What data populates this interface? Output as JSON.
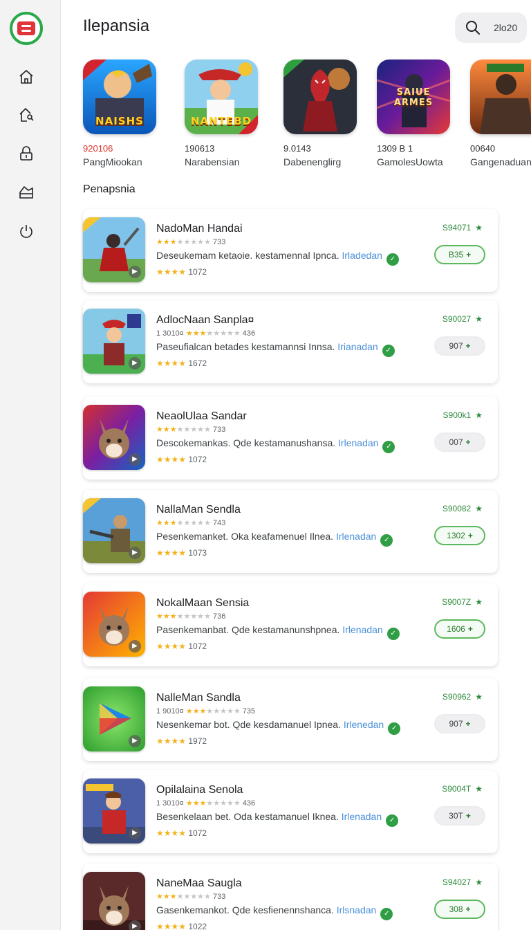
{
  "header": {
    "title": "Ilepansia",
    "search_text": "2lo20"
  },
  "nav": {
    "items": [
      "home",
      "store",
      "library",
      "deals",
      "power"
    ]
  },
  "featured": [
    {
      "number": "920106",
      "name": "PangMiookan",
      "banner": "NAISHS",
      "highlight": true
    },
    {
      "number": "190613",
      "name": "Narabensian",
      "banner": "NANTEBD",
      "highlight": false
    },
    {
      "number": "9.0143",
      "name": "Dabenenglirg",
      "banner": "",
      "highlight": false
    },
    {
      "number": "1309 B 1",
      "name": "GamolesUowta",
      "banner": "SAIUE ARMES",
      "highlight": false
    },
    {
      "number": "00640",
      "name": "Gangenaduan",
      "banner": "",
      "highlight": false
    }
  ],
  "section_title": "Penapsnia",
  "apps": [
    {
      "name": "NadoMan Handai",
      "sub_prefix": "",
      "sub_count": "733",
      "description": "Deseukemam ketaoie. kestamennal Ipnca.",
      "link": "Irladedan",
      "rating_count": "1072",
      "price": "S94071",
      "button": "B35",
      "button_style": "outline",
      "art": "warrior"
    },
    {
      "name": "AdlocNaan Sanpla¤",
      "sub_prefix": "1 3010¤",
      "sub_count": "436",
      "description": "Paseufialcan betades kestamannsi Innsa.",
      "link": "Irianadan",
      "rating_count": "1672",
      "price": "S90027",
      "button": "907",
      "button_style": "filled",
      "art": "hero"
    },
    {
      "name": "NeaolUlaa Sandar",
      "sub_prefix": "",
      "sub_count": "733",
      "description": "Descokemankas. Qde kestamanushansa.",
      "link": "Irlenadan",
      "rating_count": "1072",
      "price": "S900k1",
      "button": "007",
      "button_style": "filled",
      "art": "fox"
    },
    {
      "name": "NallaMan Sendla",
      "sub_prefix": "",
      "sub_count": "743",
      "description": "Pesenkemanket. Oka keafamenuel Ilnea.",
      "link": "Irlenadan",
      "rating_count": "1073",
      "price": "S90082",
      "button": "1302",
      "button_style": "outline",
      "art": "soldier"
    },
    {
      "name": "NokalMaan Sensia",
      "sub_prefix": "",
      "sub_count": "736",
      "description": "Pasenkemanbat. Qde kestamanunshpnea.",
      "link": "Irlenadan",
      "rating_count": "1072",
      "price": "S9007Z",
      "button": "1606",
      "button_style": "outline",
      "art": "fox2"
    },
    {
      "name": "NalleMan Sandla",
      "sub_prefix": "1 9010¤",
      "sub_count": "735",
      "description": "Nesenkemar bot. Qde kesdamanuel Ipnea.",
      "link": "Irlenedan",
      "rating_count": "1972",
      "price": "S90962",
      "button": "907",
      "button_style": "filled",
      "art": "play"
    },
    {
      "name": "Opilalaina Senola",
      "sub_prefix": "1 3010¤",
      "sub_count": "436",
      "description": "Besenkelaan bet. Oda kestamanuel Iknea.",
      "link": "Irlenadan",
      "rating_count": "1072",
      "price": "S9004T",
      "button": "30T",
      "button_style": "filled",
      "art": "hero2"
    },
    {
      "name": "NaneMaa Saugla",
      "sub_prefix": "",
      "sub_count": "733",
      "description": "Gasenkemankot. Qde kesfienennshanca.",
      "link": "Irlsnadan",
      "rating_count": "1022",
      "price": "S94027",
      "button": "308",
      "button_style": "outline",
      "art": "fox3"
    }
  ],
  "colors": {
    "accent_green": "#2e8b3d",
    "brand_red": "#e0343a",
    "star": "#f2b21b",
    "link": "#4a90d9"
  }
}
